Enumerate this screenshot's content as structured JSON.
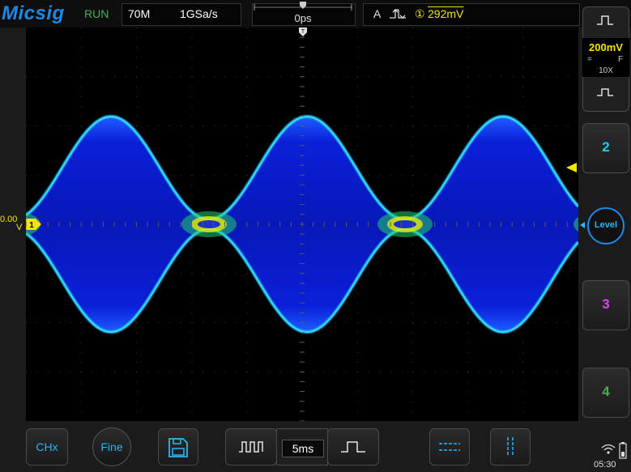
{
  "header": {
    "logo": "Micsig",
    "run_status": "RUN",
    "bandwidth": "70M",
    "sample_rate": "1GSa/s",
    "time_offset": "0ps",
    "trigger": {
      "mode": "A",
      "source": "①",
      "level": "292mV"
    }
  },
  "plot": {
    "ch1_reference": {
      "value": "0.00",
      "unit": "V",
      "marker": "1"
    },
    "waveform": "AM modulated carrier, persistence display",
    "colors": {
      "trace_core": "#0a1fd8",
      "trace_edge": "#2ee8f0",
      "trace_hot": "#f5f000",
      "ch1": "#f2e600",
      "grid": "#3a3a3a"
    }
  },
  "right_panel": {
    "ch1": {
      "scale": "200mV",
      "coupling": "=",
      "bw": "F",
      "probe": "10X",
      "icon_top": "square-wave-icon",
      "icon_bottom": "square-wave-icon"
    },
    "ch2_label": "2",
    "level_label": "Level",
    "ch3_label": "3",
    "ch4_label": "4",
    "colors": {
      "ch2": "#22c9e8",
      "ch3": "#e040fb",
      "ch4": "#4caf50"
    }
  },
  "bottom_bar": {
    "chx_label": "CHx",
    "fine_label": "Fine",
    "save_icon": "save-icon",
    "timebase": "5ms",
    "cursor_h_icon": "horizontal-cursor-icon",
    "cursor_v_icon": "vertical-cursor-icon"
  },
  "status": {
    "time": "05:30",
    "wifi_icon": "wifi-icon",
    "battery_icon": "battery-icon"
  }
}
